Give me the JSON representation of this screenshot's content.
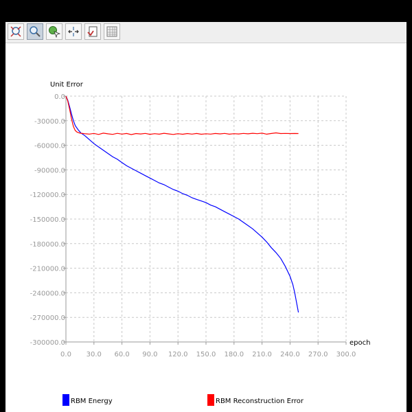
{
  "toolbar": {
    "buttons": [
      {
        "name": "zoom-fit-button",
        "icon": "zoom-fit-icon",
        "active": false
      },
      {
        "name": "zoom-button",
        "icon": "magnifier-icon",
        "active": true
      },
      {
        "name": "pan-button",
        "icon": "globe-cursor-icon",
        "active": false
      },
      {
        "name": "scale-button",
        "icon": "scale-arrows-icon",
        "active": false
      },
      {
        "name": "save-button",
        "icon": "save-file-icon",
        "active": false
      },
      {
        "name": "grid-button",
        "icon": "grid-table-icon",
        "active": false
      }
    ]
  },
  "chart_data": {
    "type": "line",
    "title": "",
    "xlabel": "epoch",
    "ylabel": "Unit Error",
    "xlim": [
      0,
      300
    ],
    "ylim": [
      -300000,
      0
    ],
    "xticks": [
      "0.0",
      "30.0",
      "60.0",
      "90.0",
      "120.0",
      "150.0",
      "180.0",
      "210.0",
      "240.0",
      "270.0",
      "300.0"
    ],
    "yticks": [
      "0.0",
      "-30000.0",
      "-60000.0",
      "-90000.0",
      "-120000.0",
      "-150000.0",
      "-180000.0",
      "-210000.0",
      "-240000.0",
      "-270000.0",
      "-300000.0"
    ],
    "grid": true,
    "legend_position": "bottom",
    "series": [
      {
        "name": "RBM Energy",
        "color": "#0000ff",
        "points": [
          [
            0,
            0
          ],
          [
            2,
            -5000
          ],
          [
            4,
            -13000
          ],
          [
            6,
            -22000
          ],
          [
            8,
            -30000
          ],
          [
            10,
            -36000
          ],
          [
            13,
            -41000
          ],
          [
            16,
            -45000
          ],
          [
            20,
            -48000
          ],
          [
            25,
            -53000
          ],
          [
            30,
            -58000
          ],
          [
            35,
            -62000
          ],
          [
            40,
            -66000
          ],
          [
            45,
            -70000
          ],
          [
            50,
            -74000
          ],
          [
            55,
            -77000
          ],
          [
            60,
            -81000
          ],
          [
            65,
            -85000
          ],
          [
            70,
            -88000
          ],
          [
            75,
            -91000
          ],
          [
            80,
            -94000
          ],
          [
            85,
            -97000
          ],
          [
            90,
            -100000
          ],
          [
            95,
            -103000
          ],
          [
            100,
            -106000
          ],
          [
            105,
            -108000
          ],
          [
            110,
            -111000
          ],
          [
            115,
            -114000
          ],
          [
            120,
            -116000
          ],
          [
            125,
            -119000
          ],
          [
            130,
            -121000
          ],
          [
            135,
            -124000
          ],
          [
            140,
            -126000
          ],
          [
            145,
            -128000
          ],
          [
            150,
            -130000
          ],
          [
            155,
            -133000
          ],
          [
            160,
            -135000
          ],
          [
            165,
            -138000
          ],
          [
            170,
            -141000
          ],
          [
            175,
            -144000
          ],
          [
            180,
            -147000
          ],
          [
            185,
            -150000
          ],
          [
            190,
            -154000
          ],
          [
            195,
            -158000
          ],
          [
            200,
            -162000
          ],
          [
            205,
            -167000
          ],
          [
            210,
            -172000
          ],
          [
            215,
            -178000
          ],
          [
            220,
            -185000
          ],
          [
            225,
            -191000
          ],
          [
            230,
            -198000
          ],
          [
            235,
            -208000
          ],
          [
            240,
            -220000
          ],
          [
            243,
            -230000
          ],
          [
            245,
            -240000
          ],
          [
            247,
            -252000
          ],
          [
            249,
            -264000
          ]
        ]
      },
      {
        "name": "RBM Reconstruction Error",
        "color": "#ff0000",
        "points": [
          [
            0,
            0
          ],
          [
            2,
            -6000
          ],
          [
            4,
            -16000
          ],
          [
            6,
            -28000
          ],
          [
            8,
            -37000
          ],
          [
            10,
            -42000
          ],
          [
            12,
            -44000
          ],
          [
            15,
            -45200
          ],
          [
            20,
            -45800
          ],
          [
            25,
            -46300
          ],
          [
            30,
            -45500
          ],
          [
            35,
            -46800
          ],
          [
            40,
            -45200
          ],
          [
            45,
            -46000
          ],
          [
            50,
            -46700
          ],
          [
            55,
            -45400
          ],
          [
            60,
            -46300
          ],
          [
            65,
            -45600
          ],
          [
            70,
            -46900
          ],
          [
            75,
            -45700
          ],
          [
            80,
            -46200
          ],
          [
            85,
            -45500
          ],
          [
            90,
            -46600
          ],
          [
            95,
            -45800
          ],
          [
            100,
            -46400
          ],
          [
            105,
            -45300
          ],
          [
            110,
            -46100
          ],
          [
            115,
            -46800
          ],
          [
            120,
            -45800
          ],
          [
            125,
            -46500
          ],
          [
            130,
            -45700
          ],
          [
            135,
            -46300
          ],
          [
            140,
            -45600
          ],
          [
            145,
            -46500
          ],
          [
            150,
            -45900
          ],
          [
            155,
            -46300
          ],
          [
            160,
            -45600
          ],
          [
            165,
            -46100
          ],
          [
            170,
            -45500
          ],
          [
            175,
            -46400
          ],
          [
            180,
            -45800
          ],
          [
            185,
            -46200
          ],
          [
            190,
            -45500
          ],
          [
            195,
            -46000
          ],
          [
            200,
            -45300
          ],
          [
            205,
            -45800
          ],
          [
            210,
            -45200
          ],
          [
            215,
            -46400
          ],
          [
            220,
            -45600
          ],
          [
            225,
            -44800
          ],
          [
            230,
            -45700
          ],
          [
            235,
            -45500
          ],
          [
            240,
            -45700
          ],
          [
            245,
            -45600
          ],
          [
            249,
            -45700
          ]
        ]
      }
    ]
  }
}
